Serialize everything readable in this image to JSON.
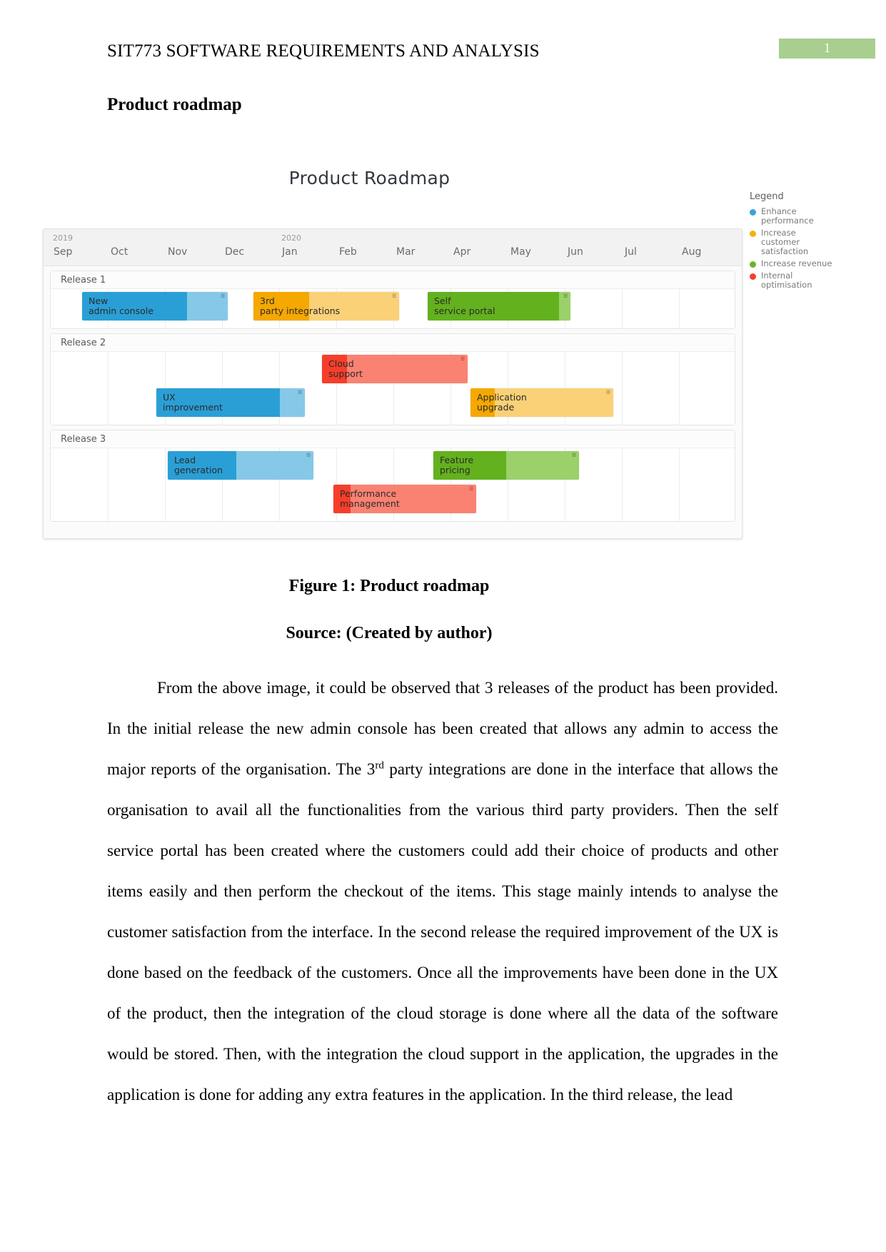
{
  "header": {
    "course_title": "SIT773 SOFTWARE REQUIREMENTS AND ANALYSIS",
    "page_number": "1"
  },
  "section": {
    "heading": "Product roadmap"
  },
  "figure": {
    "chart_title": "Product Roadmap",
    "caption": "Figure 1: Product roadmap",
    "source": "Source: (Created by author)"
  },
  "chart_data": {
    "type": "bar",
    "title": "Product Roadmap",
    "subtype": "gantt-roadmap",
    "timeline": {
      "years": [
        {
          "label": "2019",
          "start_month_index": 0
        },
        {
          "label": "2020",
          "start_month_index": 4
        }
      ],
      "months": [
        "Sep",
        "Oct",
        "Nov",
        "Dec",
        "Jan",
        "Feb",
        "Mar",
        "Apr",
        "May",
        "Jun",
        "Jul",
        "Aug"
      ]
    },
    "legend": {
      "title": "Legend",
      "position": "right",
      "items": [
        {
          "label": "Enhance performance",
          "color": "#3aa3dc"
        },
        {
          "label": "Increase customer satisfaction",
          "color": "#f5b014"
        },
        {
          "label": "Increase revenue",
          "color": "#6ab52b"
        },
        {
          "label": "Internal optimisation",
          "color": "#f3402f"
        }
      ]
    },
    "releases": [
      {
        "name": "Release 1",
        "rows": [
          [
            {
              "task": "New admin console",
              "category": "Enhance performance",
              "color": "#2a9fd6",
              "light": "#86c8e8",
              "start_month": 0.55,
              "end_month": 3.1,
              "progress": 0.72
            },
            {
              "task": "3rd party integrations",
              "category": "Increase customer satisfaction",
              "color": "#f5a800",
              "light": "#fad177",
              "start_month": 3.55,
              "end_month": 6.1,
              "progress": 0.38
            },
            {
              "task": "Self service portal",
              "category": "Increase revenue",
              "color": "#63b11e",
              "light": "#9bd06a",
              "start_month": 6.6,
              "end_month": 9.1,
              "progress": 0.92
            }
          ]
        ]
      },
      {
        "name": "Release 2",
        "rows": [
          [
            {
              "task": "Cloud support",
              "category": "Internal optimisation",
              "color": "#f63e2b",
              "light": "#fa8272",
              "start_month": 4.75,
              "end_month": 7.3,
              "progress": 0.17
            }
          ],
          [
            {
              "task": "UX improvement",
              "category": "Enhance performance",
              "color": "#2a9fd6",
              "light": "#86c8e8",
              "start_month": 1.85,
              "end_month": 4.45,
              "progress": 0.83
            },
            {
              "task": "Application upgrade",
              "category": "Increase customer satisfaction",
              "color": "#f5a800",
              "light": "#fad177",
              "start_month": 7.35,
              "end_month": 9.85,
              "progress": 0.17
            }
          ]
        ]
      },
      {
        "name": "Release 3",
        "rows": [
          [
            {
              "task": "Lead generation",
              "category": "Enhance performance",
              "color": "#2a9fd6",
              "light": "#86c8e8",
              "start_month": 2.05,
              "end_month": 4.6,
              "progress": 0.47
            },
            {
              "task": "Feature pricing",
              "category": "Increase revenue",
              "color": "#63b11e",
              "light": "#9bd06a",
              "start_month": 6.7,
              "end_month": 9.25,
              "progress": 0.5
            }
          ],
          [
            {
              "task": "Performance management",
              "category": "Internal optimisation",
              "color": "#f63e2b",
              "light": "#fa8272",
              "start_month": 4.95,
              "end_month": 7.45,
              "progress": 0.12
            }
          ]
        ]
      }
    ]
  },
  "body": {
    "paragraph_part1": "From the above image, it could be observed that 3 releases of the product has been provided. In the initial release the new admin console has been created that allows any admin to access the major reports of the organisation. The 3",
    "ordinal_suffix": "rd",
    "paragraph_part2": " party integrations are done in the interface that allows the organisation to avail all the functionalities from the various third party providers. Then the self service portal has been created where the customers could add their choice of products and other items easily and then perform the checkout of the items. This stage mainly intends to analyse the customer satisfaction from the interface. In the second release the required improvement of the UX is done based on the feedback of the customers. Once all the improvements have been done in the UX of the product, then the integration of the cloud storage is done where all the data of the software would be stored. Then, with the integration the cloud support in the application, the upgrades in the application is done for adding any extra features in the application. In the third release, the lead"
  }
}
